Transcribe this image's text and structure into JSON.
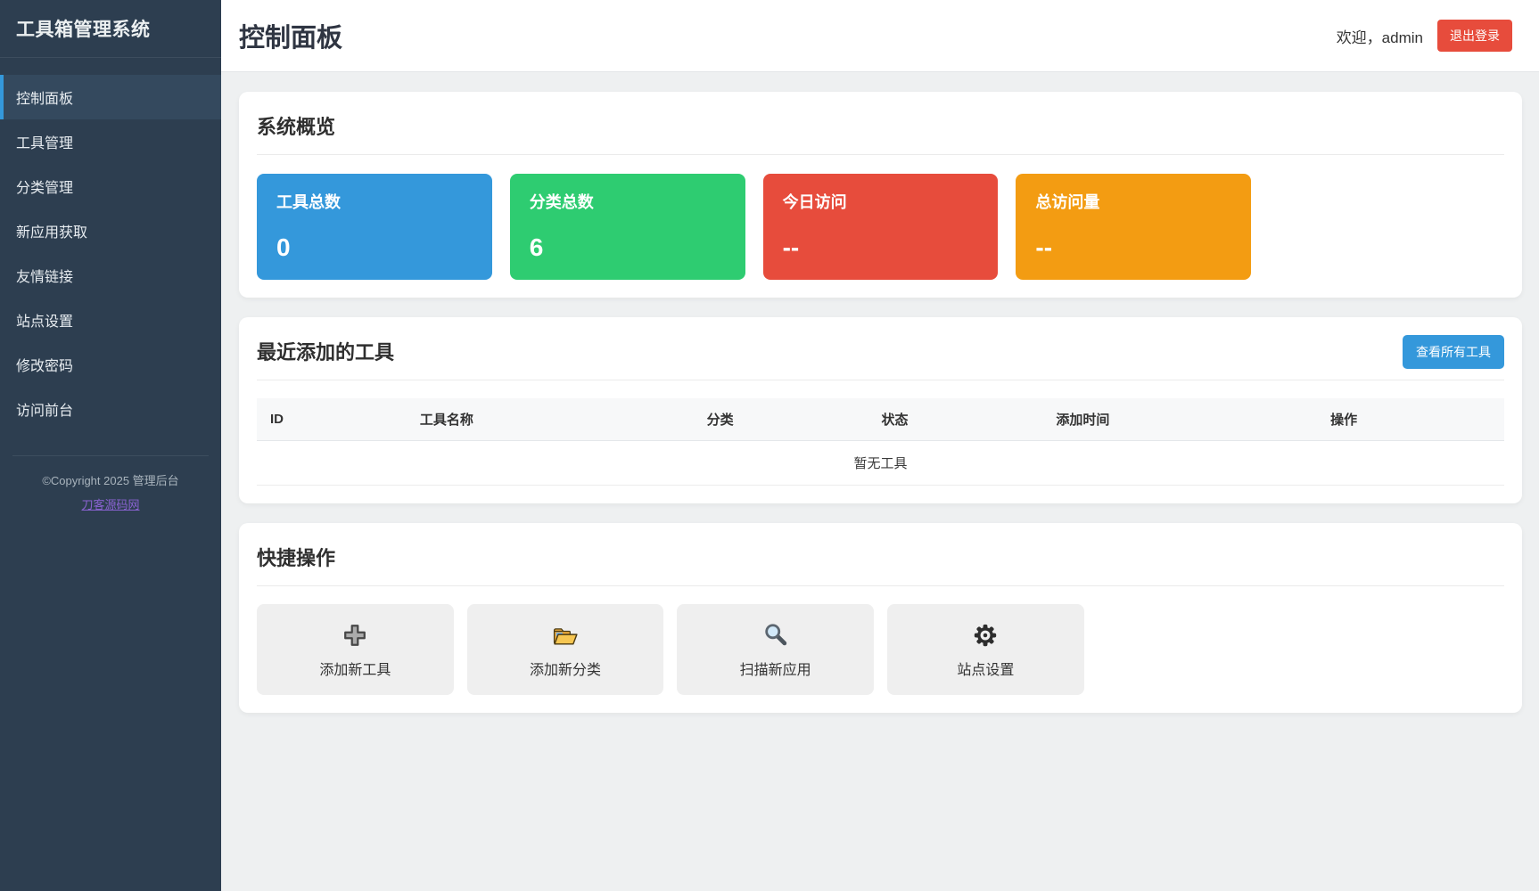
{
  "app": {
    "title": "工具箱管理系统"
  },
  "sidebar": {
    "items": [
      {
        "label": "控制面板",
        "active": true
      },
      {
        "label": "工具管理",
        "active": false
      },
      {
        "label": "分类管理",
        "active": false
      },
      {
        "label": "新应用获取",
        "active": false
      },
      {
        "label": "友情链接",
        "active": false
      },
      {
        "label": "站点设置",
        "active": false
      },
      {
        "label": "修改密码",
        "active": false
      },
      {
        "label": "访问前台",
        "active": false
      }
    ],
    "footer": {
      "copyright": "©Copyright 2025 管理后台",
      "link_text": "刀客源码网"
    }
  },
  "header": {
    "title": "控制面板",
    "welcome": "欢迎，admin",
    "logout_label": "退出登录"
  },
  "overview": {
    "heading": "系统概览",
    "stats": [
      {
        "label": "工具总数",
        "value": "0",
        "color": "#3498db"
      },
      {
        "label": "分类总数",
        "value": "6",
        "color": "#2ecc71"
      },
      {
        "label": "今日访问",
        "value": "--",
        "color": "#e74c3c"
      },
      {
        "label": "总访问量",
        "value": "--",
        "color": "#f39c12"
      }
    ]
  },
  "recent_tools": {
    "heading": "最近添加的工具",
    "view_all_label": "查看所有工具",
    "columns": [
      "ID",
      "工具名称",
      "分类",
      "状态",
      "添加时间",
      "操作"
    ],
    "empty_text": "暂无工具",
    "rows": []
  },
  "quick_actions": {
    "heading": "快捷操作",
    "actions": [
      {
        "icon": "plus-icon",
        "label": "添加新工具"
      },
      {
        "icon": "folder-icon",
        "label": "添加新分类"
      },
      {
        "icon": "search-icon",
        "label": "扫描新应用"
      },
      {
        "icon": "gear-icon",
        "label": "站点设置"
      }
    ]
  },
  "colors": {
    "sidebar_bg": "#2d3e50",
    "sidebar_active_bg": "#34495e",
    "accent_blue": "#3498db",
    "logout_red": "#e74c3c"
  }
}
